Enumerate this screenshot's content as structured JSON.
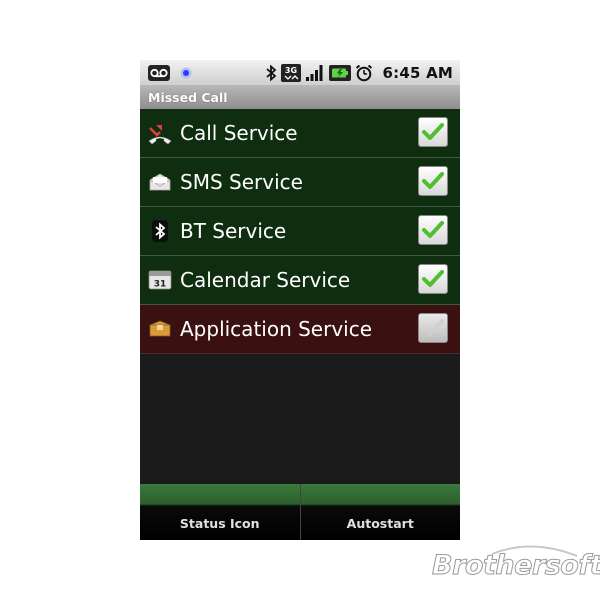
{
  "status_bar": {
    "time": "6:45 AM",
    "icons": [
      "voicemail-icon",
      "notification-dot-icon",
      "bluetooth-icon",
      "3g-icon",
      "signal-icon",
      "battery-icon",
      "alarm-icon"
    ],
    "network_label": "3G"
  },
  "title_bar": {
    "title": "Missed Call"
  },
  "services": [
    {
      "label": "Call Service",
      "icon": "missed-call-icon",
      "checked": true
    },
    {
      "label": "SMS Service",
      "icon": "envelope-icon",
      "checked": true
    },
    {
      "label": "BT Service",
      "icon": "bluetooth-icon",
      "checked": true
    },
    {
      "label": "Calendar Service",
      "icon": "calendar-icon",
      "icon_text": "31",
      "checked": true
    },
    {
      "label": "Application Service",
      "icon": "package-icon",
      "checked": false,
      "highlighted": true
    }
  ],
  "bottom_buttons": {
    "status_icon": "Status Icon",
    "autostart": "Autostart"
  },
  "watermark": {
    "text": "Brothersoft"
  },
  "colors": {
    "row_bg": "#0f2d0f",
    "selected_row_bg": "#3a1010",
    "check_green": "#4fbf2f",
    "button_green": "#3c7a3c"
  }
}
